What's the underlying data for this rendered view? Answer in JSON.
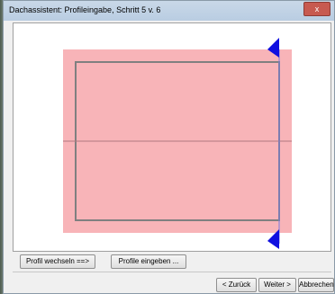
{
  "window": {
    "title": "Dachassistent: Profileingabe, Schritt 5 v. 6",
    "close_glyph": "x"
  },
  "buttons": {
    "profile_switch": "Profil  wechseln  ==>",
    "profile_enter": "Profile eingeben ...",
    "back": "< Zurück",
    "next": "Weiter >",
    "cancel": "Abbrechen"
  },
  "colors": {
    "roof_fill": "#f8b4b8",
    "outline": "#808080",
    "marker": "#1010e0"
  },
  "icons": {
    "top_marker": "blue-triangle-marker-icon",
    "bottom_marker": "blue-triangle-marker-icon"
  }
}
